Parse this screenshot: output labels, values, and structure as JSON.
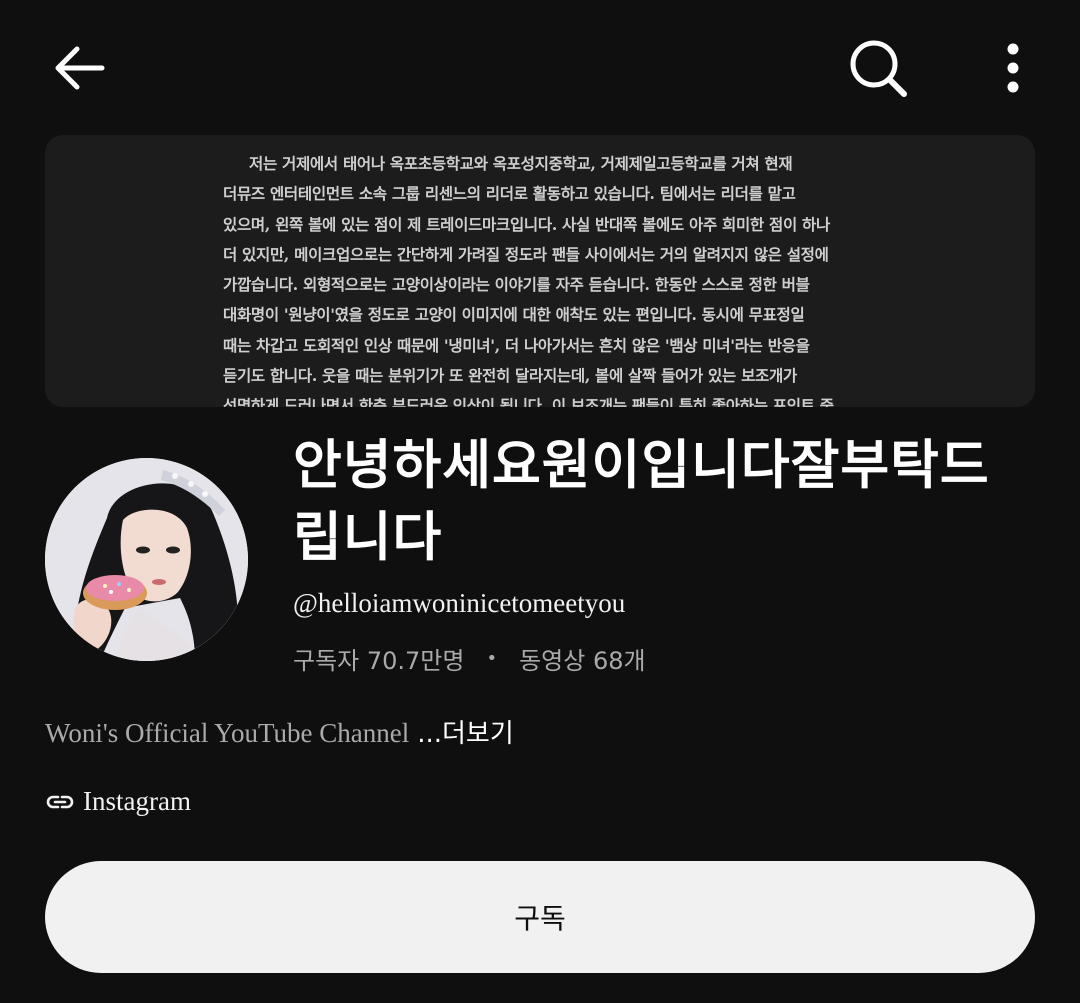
{
  "header": {
    "icons": [
      "back-arrow-icon",
      "search-icon",
      "more-vertical-icon"
    ]
  },
  "banner": {
    "lines": [
      "저는 거제에서 태어나 옥포초등학교와 옥포성지중학교, 거제제일고등학교를 거쳐 현재",
      "더뮤즈 엔터테인먼트 소속 그룹 리센느의 리더로 활동하고 있습니다. 팀에서는 리더를 맡고",
      "있으며, 왼쪽 볼에 있는 점이 제 트레이드마크입니다. 사실 반대쪽 볼에도 아주 희미한 점이 하나",
      "더 있지만, 메이크업으로는 간단하게 가려질 정도라 팬들 사이에서는 거의 알려지지 않은 설정에",
      "가깝습니다. 외형적으로는 고양이상이라는 이야기를 자주 듣습니다. 한동안 스스로 정한 버블",
      "대화명이 '원냥이'였을 정도로 고양이 이미지에 대한 애착도 있는 편입니다. 동시에 무표정일",
      "때는 차갑고 도회적인 인상 때문에 '냉미녀', 더 나아가서는 흔치 않은 '뱀상 미녀'라는 반응을",
      "듣기도 합니다. 웃을 때는 분위기가 또 완전히 달라지는데, 볼에 살짝 들어가 있는 보조개가",
      "선명하게 드러나면서 한층 부드러운 인상이 됩니다. 이 보조개는 팬들이 특히 좋아하는 포인트 중"
    ]
  },
  "channel": {
    "title": "안녕하세요원이입니다잘부탁드립니다",
    "handle": "@helloiamwoninicetomeetyou",
    "subscribers": "구독자 70.7만명",
    "separator": "•",
    "videos": "동영상 68개",
    "description": "Woni's Official YouTube Channel",
    "more_label": "...더보기",
    "link_label": "Instagram",
    "subscribe_label": "구독"
  },
  "colors": {
    "background": "#0f0f0f",
    "banner_bg": "#1c1c1c",
    "secondary_text": "#aaaaaa",
    "button_bg": "#f1f1f1"
  }
}
